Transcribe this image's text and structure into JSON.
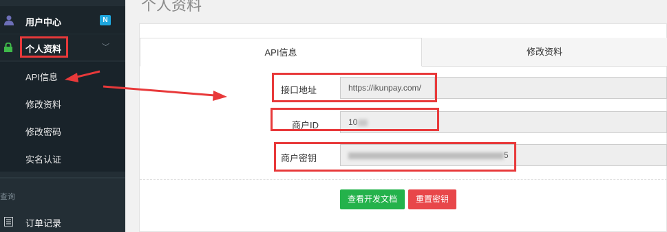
{
  "page": {
    "title": "个人资料"
  },
  "sidebar": {
    "user_center": {
      "label": "用户中心",
      "badge": "N"
    },
    "profile": {
      "label": "个人资料"
    },
    "sub_items": [
      {
        "label": "API信息"
      },
      {
        "label": "修改资料"
      },
      {
        "label": "修改密码"
      },
      {
        "label": "实名认证"
      }
    ],
    "section_label": "查询",
    "orders": {
      "label": "订单记录"
    }
  },
  "tabs": [
    {
      "label": "API信息",
      "active": true
    },
    {
      "label": "修改资料",
      "active": false
    }
  ],
  "form": {
    "api_url": {
      "label": "接口地址",
      "value": "https://ikunpay.com/"
    },
    "merchant_id": {
      "label": "商户ID",
      "value": "10"
    },
    "merchant_key": {
      "label": "商户密钥",
      "value": "5"
    }
  },
  "buttons": {
    "docs": "查看开发文档",
    "reset_key": "重置密钥"
  },
  "colors": {
    "sidebar_bg": "#232e35",
    "annotation_red": "#e8393a",
    "btn_green": "#24b24b",
    "btn_red": "#e8474a",
    "badge_blue": "#1ea6dd"
  }
}
